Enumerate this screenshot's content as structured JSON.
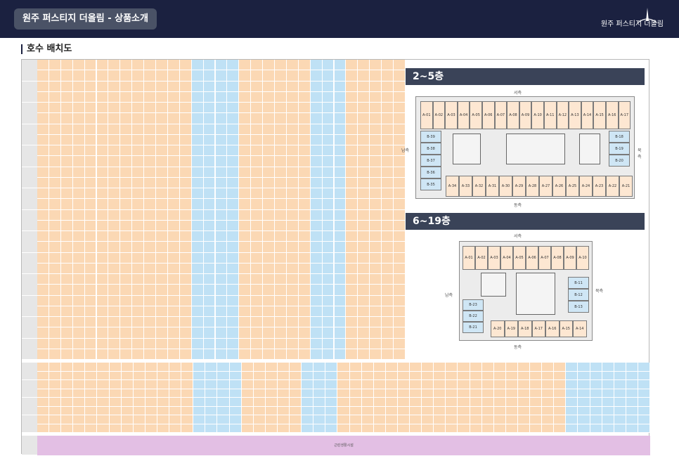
{
  "header": {
    "title": "원주 퍼스티지 더올림 - 상품소개",
    "logo_text": "원주 퍼스티지 더올림"
  },
  "section": {
    "title": "호수 배치도"
  },
  "grid": {
    "retail_label": "근린생활시설"
  },
  "panels": [
    {
      "title": "2~5층",
      "west": "서측",
      "east": "동측",
      "south": "남측",
      "north": "북측",
      "top_rooms": [
        "A-01",
        "A-02",
        "A-03",
        "A-04",
        "A-05",
        "A-06",
        "A-07",
        "A-08",
        "A-09",
        "A-10",
        "A-11",
        "A-12",
        "A-13",
        "A-14",
        "A-15",
        "A-16",
        "A-17"
      ],
      "bottom_rooms": [
        "A-34",
        "A-33",
        "A-32",
        "A-31",
        "A-30",
        "A-29",
        "A-28",
        "A-27",
        "A-26",
        "A-25",
        "A-24",
        "A-23",
        "A-22",
        "A-21"
      ],
      "left_rooms": [
        "B-39",
        "B-38",
        "B-37",
        "B-36",
        "B-35"
      ],
      "right_rooms": [
        "B-18",
        "B-19",
        "B-20"
      ]
    },
    {
      "title": "6~19층",
      "west": "서측",
      "east": "동측",
      "south": "남측",
      "north": "북측",
      "top_rooms": [
        "A-01",
        "A-02",
        "A-03",
        "A-04",
        "A-05",
        "A-06",
        "A-07",
        "A-08",
        "A-09",
        "A-10"
      ],
      "bottom_rooms": [
        "A-20",
        "A-19",
        "A-18",
        "A-17",
        "A-16",
        "A-15",
        "A-14"
      ],
      "left_rooms": [
        "B-23",
        "B-22",
        "B-21"
      ],
      "right_rooms": [
        "B-11",
        "B-12",
        "B-13"
      ]
    }
  ],
  "colors": {
    "header_bg": "#1b2140",
    "unit_a": "#fbd8b4",
    "unit_b": "#bfe1f5",
    "retail": "#e3bfe4",
    "panel_title_bg": "#3a4358"
  }
}
